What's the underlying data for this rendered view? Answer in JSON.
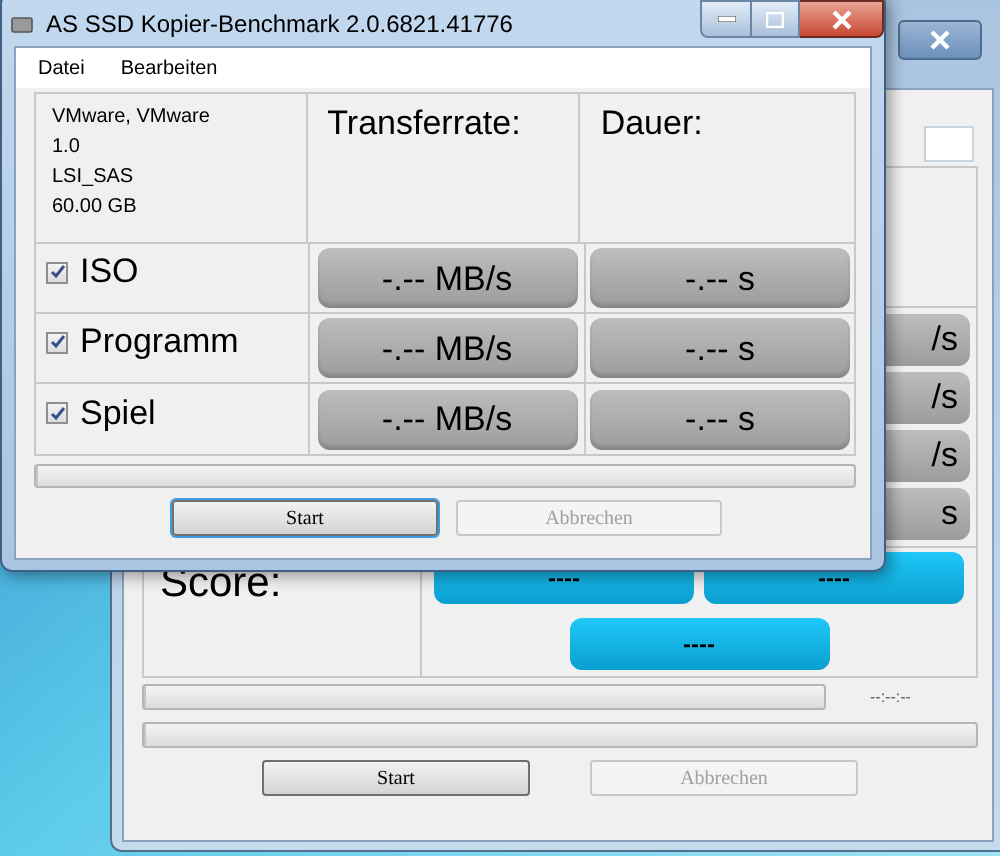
{
  "back_window": {
    "cells": [
      "/s",
      "/s",
      "/s",
      "s"
    ],
    "score": {
      "label": "Score:",
      "values": [
        "----",
        "----",
        "----"
      ]
    },
    "time": "--:--:--",
    "progress": [
      {
        "level": 0
      },
      {
        "level": 0
      }
    ],
    "buttons": [
      {
        "label": "Start",
        "disabled": false
      },
      {
        "label": "Abbrechen",
        "disabled": true
      }
    ]
  },
  "window": {
    "title": "AS SSD Kopier-Benchmark 2.0.6821.41776",
    "menu": [
      "Datei",
      "Bearbeiten"
    ],
    "drive_info": [
      "VMware, VMware",
      "1.0",
      "LSI_SAS",
      "60.00 GB"
    ],
    "columns": [
      "Transferrate:",
      "Dauer:"
    ],
    "rows": [
      {
        "label": "ISO",
        "checked": true,
        "rate": "-.-- MB/s",
        "duration": "-.-- s"
      },
      {
        "label": "Programm",
        "checked": true,
        "rate": "-.-- MB/s",
        "duration": "-.-- s"
      },
      {
        "label": "Spiel",
        "checked": true,
        "rate": "-.-- MB/s",
        "duration": "-.-- s"
      }
    ],
    "progress": {
      "level": 0
    },
    "buttons": [
      {
        "label": "Start",
        "disabled": false
      },
      {
        "label": "Abbrechen",
        "disabled": true
      }
    ]
  }
}
